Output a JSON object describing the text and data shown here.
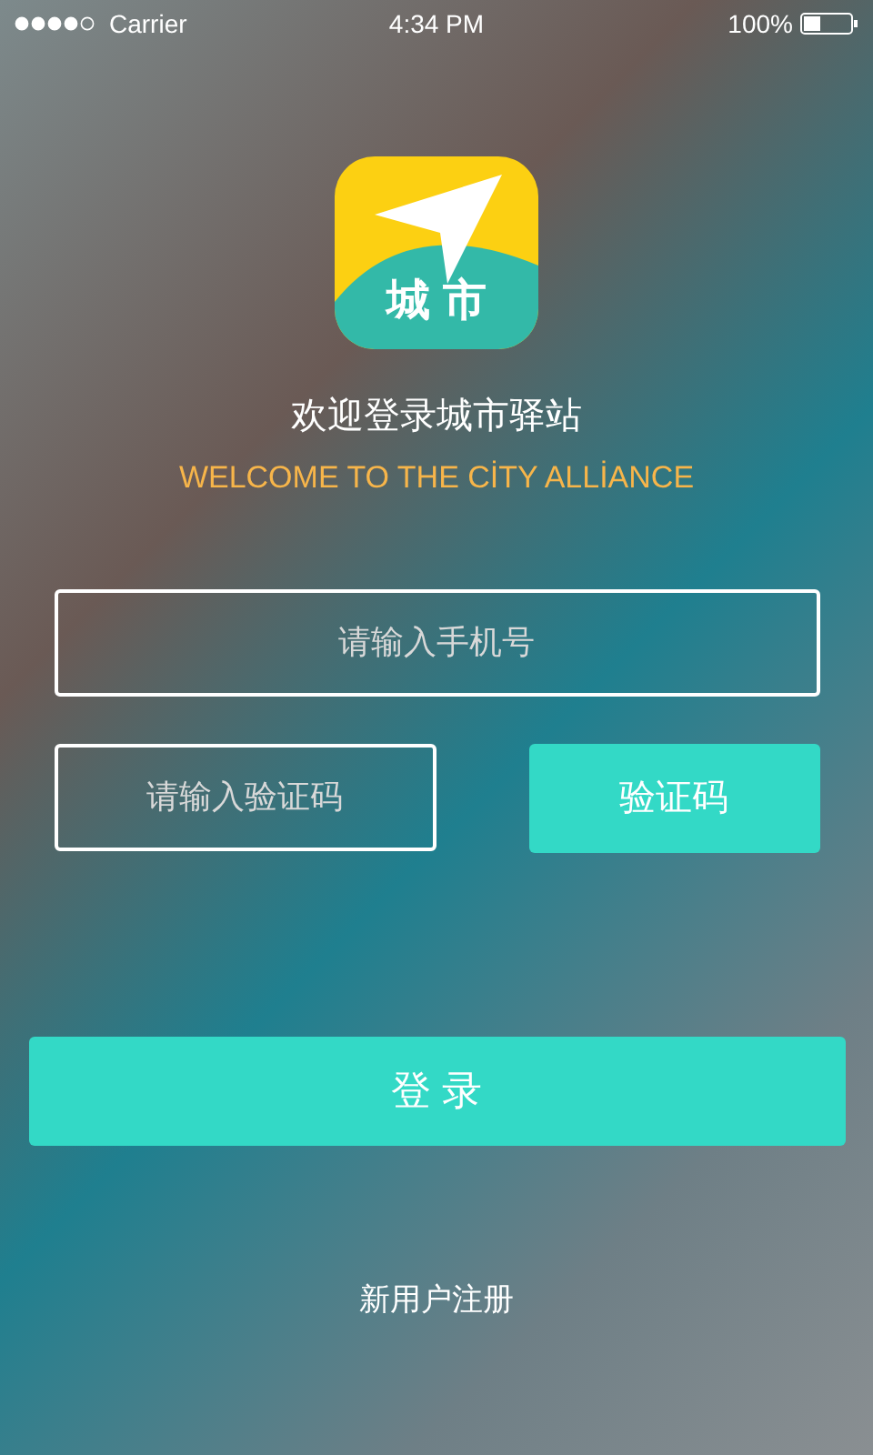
{
  "status_bar": {
    "carrier": "Carrier",
    "time": "4:34 PM",
    "battery": "100%"
  },
  "logo": {
    "text": "城 市"
  },
  "title": "欢迎登录城市驿站",
  "subtitle": "WELCOME TO THE CİTY ALLİANCE",
  "phone_field": {
    "placeholder": "请输入手机号"
  },
  "code_field": {
    "placeholder": "请输入验证码"
  },
  "code_button": "验证码",
  "login_button": "登 录",
  "register_link": "新用户注册"
}
